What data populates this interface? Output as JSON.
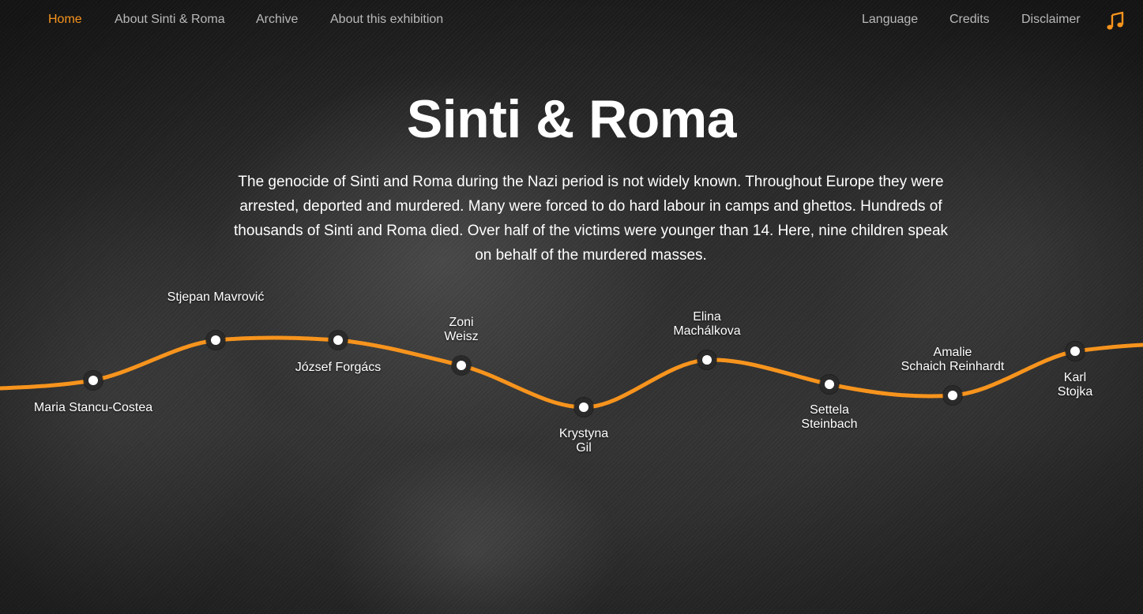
{
  "nav": {
    "left": [
      "Home",
      "About Sinti & Roma",
      "Archive",
      "About this exhibition"
    ],
    "right": [
      "Language",
      "Credits",
      "Disclaimer"
    ],
    "music_icon": "music-note-icon",
    "active": "Home",
    "accent_color": "#f7941d"
  },
  "hero": {
    "title": "Sinti & Roma",
    "intro": "The genocide of Sinti and Roma during the Nazi period is not widely known. Throughout Europe they were arrested, deported and murdered. Many were forced to do hard labour in camps and ghettos. Hundreds of thousands of Sinti and Roma died. Over half of the victims were younger than 14. Here, nine children speak on behalf of the murdered masses."
  },
  "timeline": {
    "line_color": "#f7941d",
    "children": [
      {
        "lines": [
          "Maria Stancu-Costea"
        ]
      },
      {
        "lines": [
          "Stjepan Mavrović"
        ]
      },
      {
        "lines": [
          "József Forgács"
        ]
      },
      {
        "lines": [
          "Zoni",
          "Weisz"
        ]
      },
      {
        "lines": [
          "Krystyna",
          "Gil"
        ]
      },
      {
        "lines": [
          "Elina",
          "Machálkova"
        ]
      },
      {
        "lines": [
          "Settela",
          "Steinbach"
        ]
      },
      {
        "lines": [
          "Amalie",
          "Schaich Reinhardt"
        ]
      },
      {
        "lines": [
          "Karl",
          "Stojka"
        ]
      }
    ]
  }
}
